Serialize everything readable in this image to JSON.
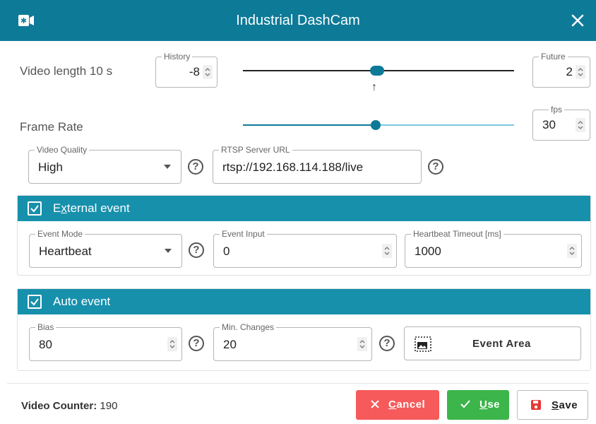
{
  "window": {
    "title": "Industrial DashCam",
    "app_icon": "camera-icon",
    "close_icon": "close-icon"
  },
  "video_length": {
    "label": "Video length 10 s",
    "history": {
      "legend": "History",
      "value": "-8"
    },
    "future": {
      "legend": "Future",
      "value": "2"
    },
    "slider_icon": "arrow-up-icon",
    "slider_marker": "↑"
  },
  "frame_rate": {
    "label": "Frame Rate",
    "fps": {
      "legend": "fps",
      "value": "30"
    }
  },
  "video_quality": {
    "legend": "Video Quality",
    "value": "High"
  },
  "rtsp": {
    "legend": "RTSP Server URL",
    "value": "rtsp://192.168.114.188/live"
  },
  "help_glyph": "?",
  "external_event": {
    "title_prefix": "E",
    "title_underlined": "x",
    "title_rest": "ternal event",
    "checked": true,
    "event_mode": {
      "legend": "Event Mode",
      "value": "Heartbeat"
    },
    "event_input": {
      "legend": "Event Input",
      "value": "0"
    },
    "heartbeat_timeout": {
      "legend": "Heartbeat Timeout [ms]",
      "value": "1000"
    }
  },
  "auto_event": {
    "title": "Auto event",
    "checked": true,
    "bias": {
      "legend": "Bias",
      "value": "80"
    },
    "min_changes": {
      "legend": "Min. Changes",
      "value": "20"
    },
    "event_area_label": "Event Area"
  },
  "footer": {
    "counter_label": "Video Counter:",
    "counter_value": "190",
    "cancel": {
      "underlined": "C",
      "rest": "ancel"
    },
    "use": {
      "underlined": "U",
      "rest": "se"
    },
    "save": {
      "underlined": "S",
      "rest": "ave"
    }
  },
  "colors": {
    "titlebar": "#0d7a98",
    "section_header": "#1790ac",
    "cancel": "#f65a5a",
    "use": "#3cb54a",
    "save_icon": "#e53935",
    "slider_active": "#0d7a98",
    "slider_inactive": "#7ec8dc"
  }
}
